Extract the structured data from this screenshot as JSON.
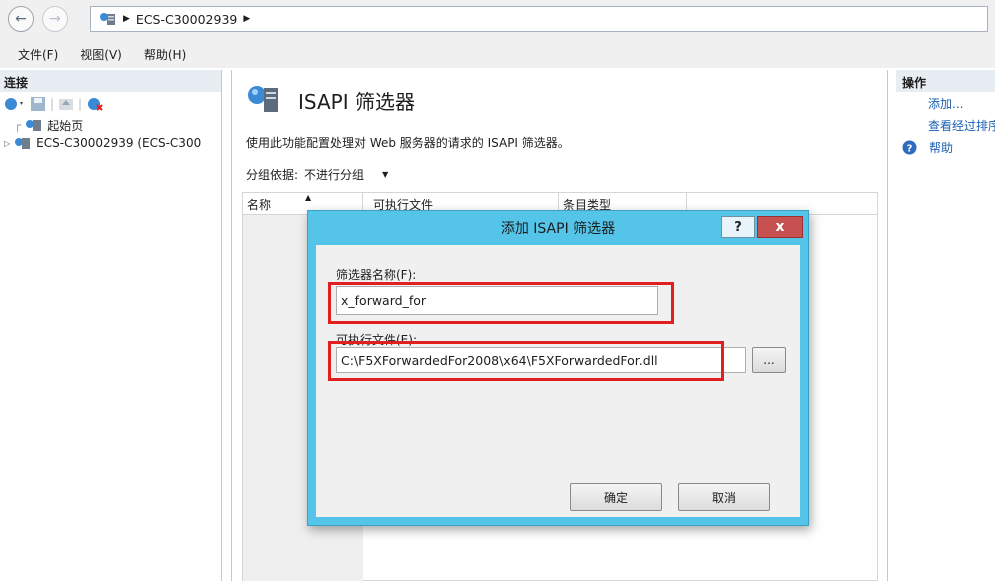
{
  "address": {
    "host": "ECS-C30002939"
  },
  "menu": {
    "file": "文件(F)",
    "view": "视图(V)",
    "help": "帮助(H)"
  },
  "left": {
    "header": "连接",
    "tree": [
      {
        "label": "起始页"
      },
      {
        "label": "ECS-C30002939 (ECS-C300"
      }
    ]
  },
  "main": {
    "title": "ISAPI 筛选器",
    "description": "使用此功能配置处理对 Web 服务器的请求的 ISAPI 筛选器。",
    "group_label": "分组依据:",
    "group_value": "不进行分组",
    "columns": [
      "名称",
      "可执行文件",
      "条目类型"
    ]
  },
  "actions": {
    "header": "操作",
    "add": "添加...",
    "view_sorted": "查看经过排序",
    "help": "帮助"
  },
  "dialog": {
    "title": "添加 ISAPI 筛选器",
    "help_glyph": "?",
    "close_glyph": "x",
    "name_label": "筛选器名称(F):",
    "name_value": "x_forward_for",
    "exe_label": "可执行文件(E):",
    "exe_value": "C:\\F5XForwardedFor2008\\x64\\F5XForwardedFor.dll",
    "browse_label": "...",
    "ok": "确定",
    "cancel": "取消"
  },
  "colors": {
    "dialog_frame": "#54c5e9",
    "highlight": "#e31e1e",
    "link": "#1a5fb4",
    "close": "#c75050"
  }
}
